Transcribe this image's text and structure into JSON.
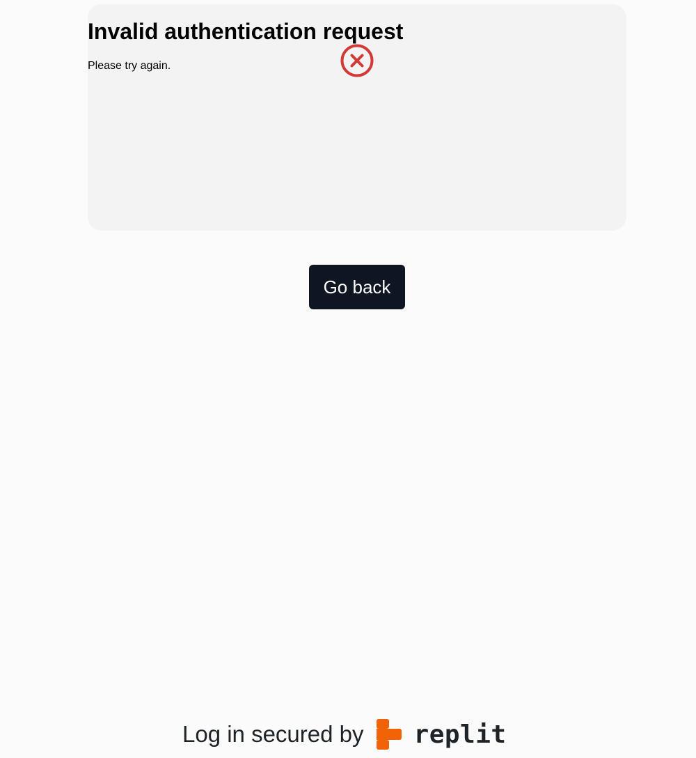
{
  "error_card": {
    "icon": "x-circle-icon",
    "icon_color": "#d13a35",
    "title": "Invalid authentication request",
    "subtitle": "Please try again."
  },
  "actions": {
    "go_back_label": "Go back"
  },
  "footer": {
    "secured_text": "Log in secured by",
    "brand_name": "replit",
    "brand_color": "#f26207"
  }
}
